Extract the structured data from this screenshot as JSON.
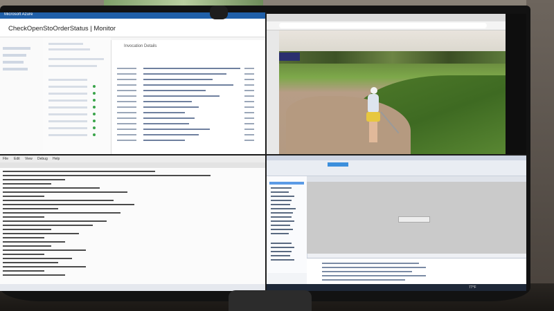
{
  "top_left": {
    "app_title": "Microsoft Azure",
    "page_title": "CheckOpenStoOrderStatus | Monitor",
    "detail_title": "Invocation Details"
  },
  "top_right": {
    "tab_label": ""
  },
  "bottom_left": {
    "menu_items": [
      "File",
      "Edit",
      "View",
      "Debug",
      "Help"
    ]
  },
  "bottom_right": {
    "window_title": "",
    "weather": "77°F",
    "time": ""
  }
}
